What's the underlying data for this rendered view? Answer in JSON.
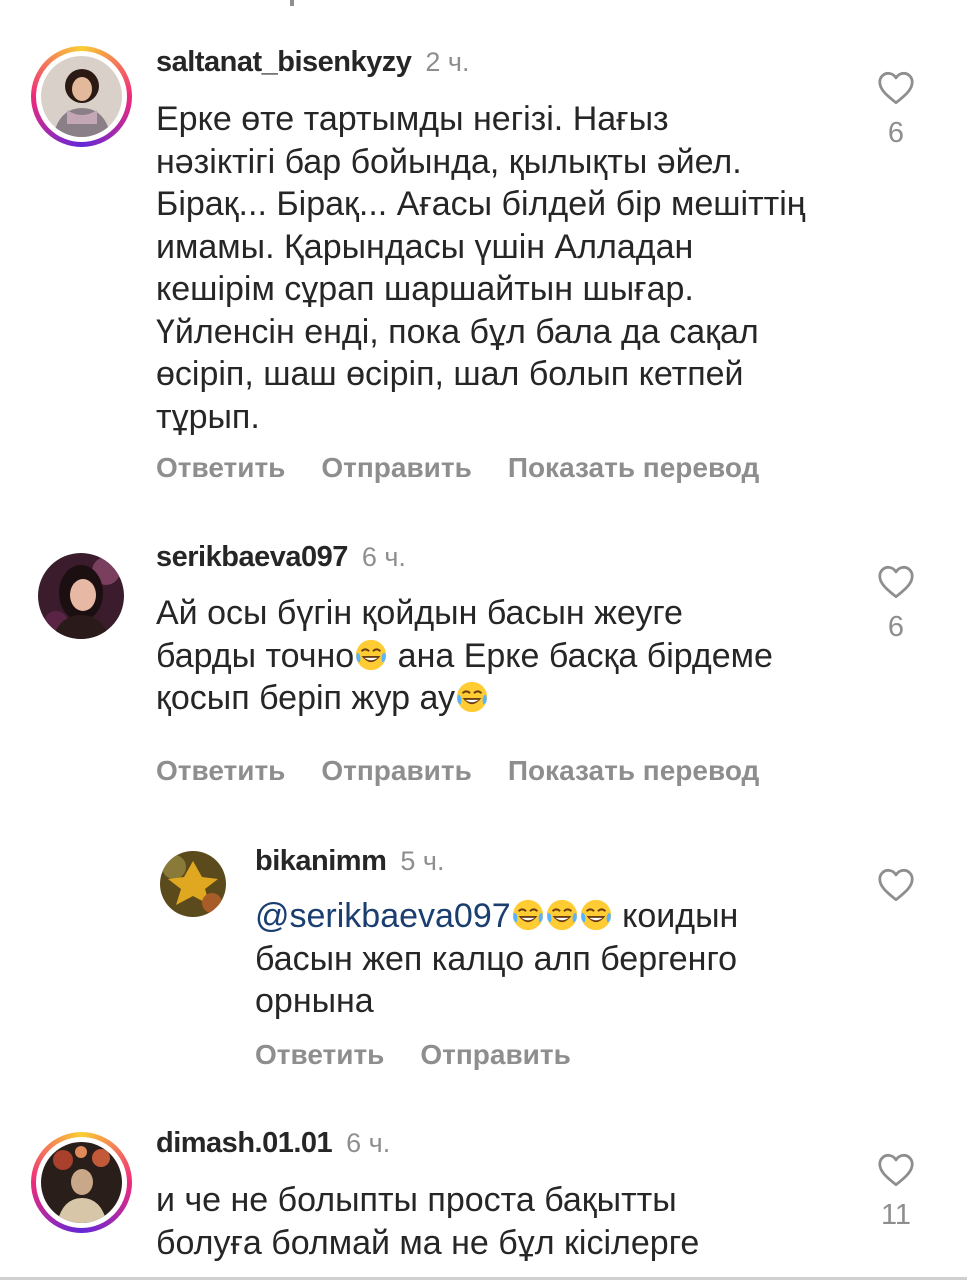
{
  "comments": [
    {
      "username": "saltanat_bisenkyzy",
      "time": "2 ч.",
      "lines": [
        "Ерке өте тартымды негізі. Нағыз",
        "нәзіктігі бар бойында, қылықты әйел.",
        "Бірақ... Бірақ... Ағасы білдей бір мешіттің",
        "имамы. Қарындасы үшін Алладан",
        "кешірім сұрап шаршайтын шығар.",
        "Үйленсін енді, пока бұл бала да сақал",
        "өсіріп, шаш өсіріп, шал болып кетпей",
        "тұрып."
      ],
      "likes": "6",
      "actions": {
        "reply": "Ответить",
        "send": "Отправить",
        "translate": "Показать перевод"
      }
    },
    {
      "username": "serikbaeva097",
      "time": "6 ч.",
      "line1": "Ай осы бүгін қойдын басын жеуге",
      "line2_a": "барды точно",
      "line2_b": " ана Ерке басқа бірдеме",
      "line3": "қосып беріп жур ау",
      "likes": "6",
      "actions": {
        "reply": "Ответить",
        "send": "Отправить",
        "translate": "Показать перевод"
      }
    },
    {
      "username": "bikanimm",
      "time": "5 ч.",
      "mention": "@serikbaeva097",
      "line1_rest": " коидын",
      "line2": "басын жеп калцо алп бергенго",
      "line3": "орнына",
      "actions": {
        "reply": "Ответить",
        "send": "Отправить"
      }
    },
    {
      "username": "dimash.01.01",
      "time": "6 ч.",
      "line1": "и че не болыпты  проста бақытты",
      "line2": "болуға болмай ма не бұл кісілерге",
      "likes": "11"
    }
  ],
  "icons": {
    "like": "heart-outline-icon",
    "emoji": "tears-of-joy-emoji"
  },
  "colors": {
    "text": "#262626",
    "secondary": "#8e8e8e",
    "mention": "#1a3e70"
  }
}
